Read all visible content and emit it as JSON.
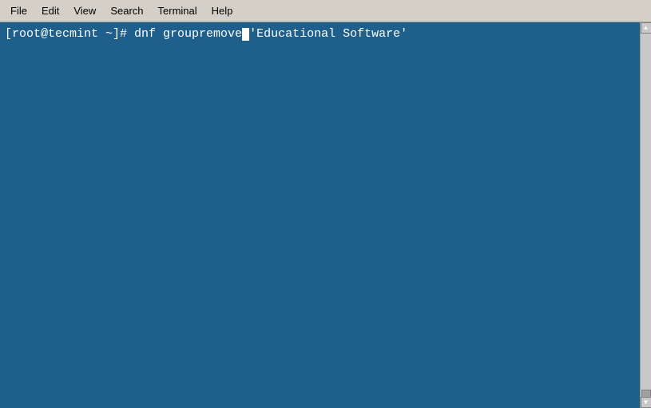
{
  "menubar": {
    "items": [
      {
        "label": "File",
        "id": "file"
      },
      {
        "label": "Edit",
        "id": "edit"
      },
      {
        "label": "View",
        "id": "view"
      },
      {
        "label": "Search",
        "id": "search"
      },
      {
        "label": "Terminal",
        "id": "terminal"
      },
      {
        "label": "Help",
        "id": "help"
      }
    ]
  },
  "terminal": {
    "prompt": "[root@tecmint ~]# ",
    "command": "dnf groupremove",
    "argument": "'Educational Software'",
    "full_line": "[root@tecmint ~]# dnf groupremove█'Educational Software'"
  },
  "colors": {
    "terminal_bg": "#1f5f8b",
    "menubar_bg": "#d4d0c8",
    "text": "#ffffff"
  }
}
